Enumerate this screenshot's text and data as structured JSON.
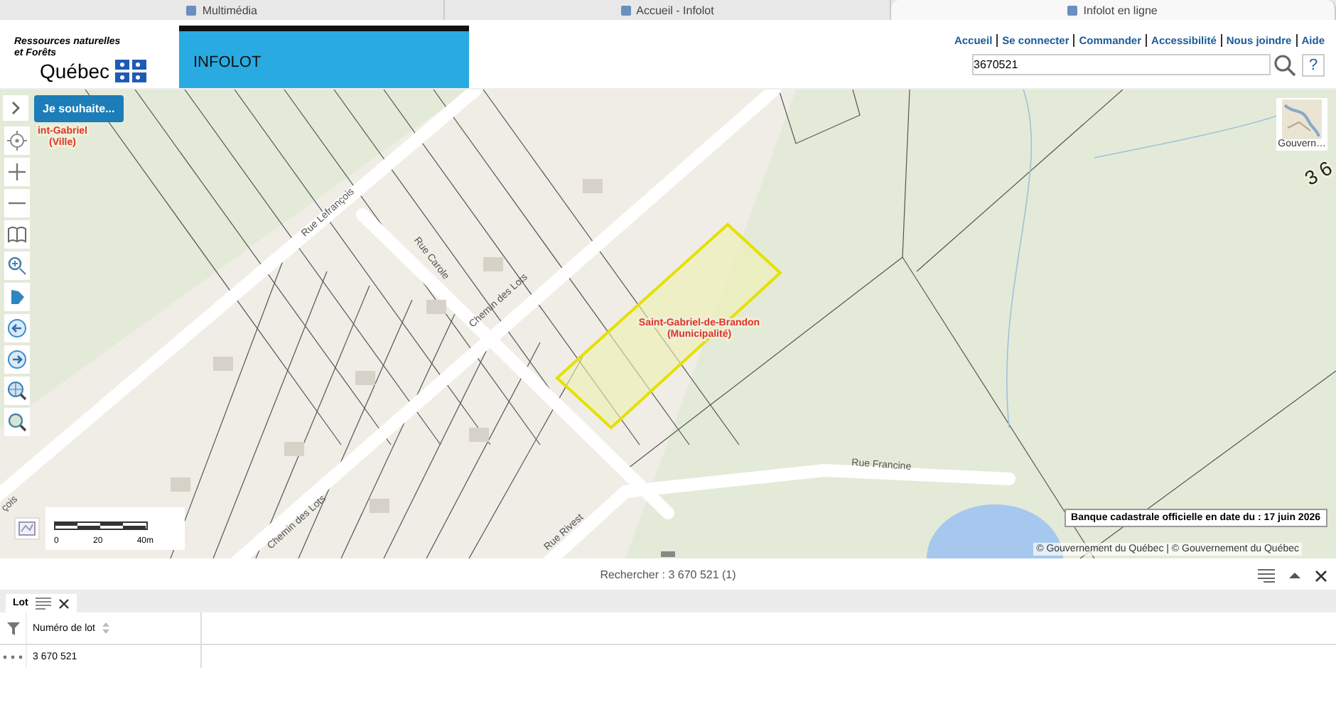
{
  "browser_tabs": [
    {
      "label": "Multimédia",
      "selected": false
    },
    {
      "label": "Accueil - Infolot",
      "selected": false
    },
    {
      "label": "Infolot en ligne",
      "selected": true
    }
  ],
  "header": {
    "ministry": "Ressources naturelles et Forêts",
    "logo_word": "Québec",
    "app_title": "INFOLOT",
    "nav_links": [
      "Accueil",
      "Se connecter",
      "Commander",
      "Accessibilité",
      "Nous joindre",
      "Aide"
    ],
    "search": {
      "value": "3670521"
    },
    "help": "?"
  },
  "map": {
    "wish_button": "Je souhaite...",
    "place_labels": [
      {
        "kind": "place",
        "text": "int-Gabriel\n(Ville)"
      },
      {
        "kind": "place",
        "text": "Saint-Gabriel-de-Brandon\n(Municipalité)"
      },
      {
        "kind": "lot",
        "text": "3 6"
      }
    ],
    "street_labels": [
      "Rue Lefrançois",
      "Rue Carole",
      "Chemin des Lots",
      "Chemin des Lots",
      "Rue Rivest",
      "Rue Francine",
      "çois"
    ],
    "scale_labels": [
      "0",
      "20",
      "40m"
    ],
    "basemap_label": "Gouvern…",
    "cadastre_notice": "Banque cadastrale officielle en date du : 17 juin 2026",
    "attribution": "© Gouvernement du Québec | © Gouvernement du Québec"
  },
  "results": {
    "title": "Rechercher : 3 670 521 (1)",
    "tabs": [
      {
        "label": "Lot",
        "selected": true
      }
    ],
    "columns": [
      "Numéro de lot"
    ],
    "rows": [
      [
        "3 670 521"
      ]
    ]
  }
}
